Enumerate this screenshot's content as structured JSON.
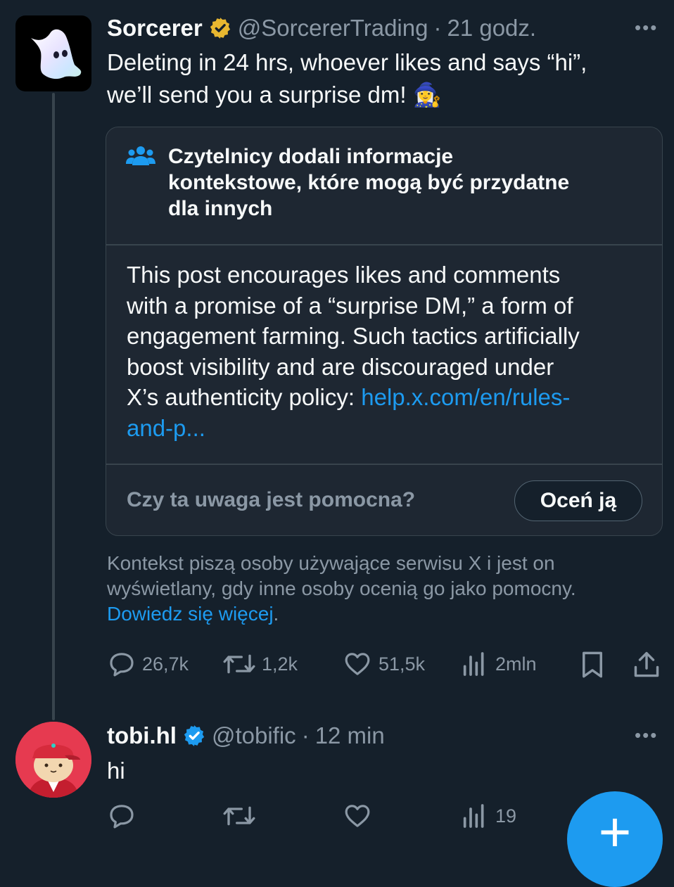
{
  "tweet": {
    "author_name": "Sorcerer",
    "author_handle": "@SorcererTrading",
    "separator": "·",
    "time": "21 godz.",
    "more_label": "•••",
    "text_line1": "Deleting in 24 hrs, whoever likes and says “hi”,",
    "text_line2": "we’ll send you a surprise dm! 🧙‍♀️"
  },
  "community_note": {
    "header_line1": "Czytelnicy dodali informacje",
    "header_line2": "kontekstowe, które mogą być przydatne",
    "header_line3": "dla innych",
    "body_line1": "This post encourages likes and comments",
    "body_line2": "with a promise of a “surprise DM,” a form of",
    "body_line3": "engagement farming. Such tactics artificially",
    "body_line4": "boost visibility and are discouraged under",
    "body_line5_text": "X’s authenticity policy: ",
    "body_line5_link": "help.x.com/en/rules-",
    "body_line6_link": "and-p...",
    "rate_question": "Czy ta uwaga jest pomocna?",
    "rate_button": "Oceń ją"
  },
  "context_info": {
    "line1": "Kontekst piszą osoby używające serwisu X i jest on",
    "line2": "wyświetlany, gdy inne osoby ocenią go jako pomocny.",
    "learn_more": "Dowiedz się więcej",
    "period": "."
  },
  "tweet_actions": {
    "replies": "26,7k",
    "reposts": "1,2k",
    "likes": "51,5k",
    "views": "2mln"
  },
  "reply": {
    "author_name": "tobi.hl",
    "author_handle": "@tobific",
    "separator": "·",
    "time": "12 min",
    "more_label": "•••",
    "text": "hi",
    "views": "19"
  },
  "fab": {
    "label": "+"
  },
  "colors": {
    "background": "#15202b",
    "accent": "#1d9bf0",
    "muted": "#8b98a5",
    "gold_badge": "#e8b730"
  }
}
